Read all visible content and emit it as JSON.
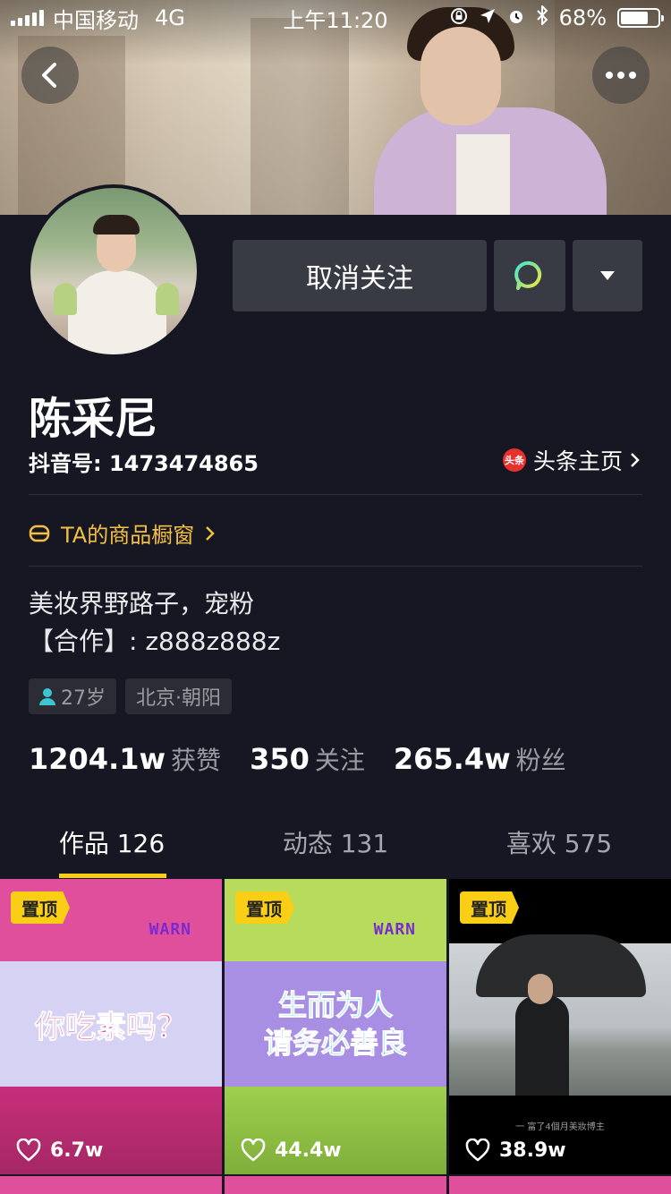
{
  "status_bar": {
    "carrier": "中国移动",
    "network": "4G",
    "time": "上午11:20",
    "battery": "68%",
    "battery_level": 0.68
  },
  "header": {
    "back_icon": "chevron-left-icon",
    "more_icon": "more-dots-icon"
  },
  "actions": {
    "unfollow_label": "取消关注",
    "message_icon": "message-bubble-icon",
    "dropdown_icon": "triangle-down-icon"
  },
  "profile": {
    "name": "陈采尼",
    "douyin_id": "抖音号: 1473474865",
    "toutiao_logo": "头条",
    "toutiao_label": "头条主页",
    "shop_label": "TA的商品橱窗",
    "bio_line1": "美妆界野路子，宠粉",
    "bio_line2": "【合作】: z888z888z",
    "tags": {
      "age": "27岁",
      "location": "北京·朝阳"
    }
  },
  "stats": [
    {
      "num": "1204.1w",
      "label": "获赞"
    },
    {
      "num": "350",
      "label": "关注"
    },
    {
      "num": "265.4w",
      "label": "粉丝"
    }
  ],
  "tabs": [
    {
      "label": "作品 126"
    },
    {
      "label": "动态 131"
    },
    {
      "label": "喜欢 575"
    }
  ],
  "videos": [
    {
      "pin": "置顶",
      "warn": "WARN",
      "title": "你吃素吗？",
      "likes": "6.7w"
    },
    {
      "pin": "置顶",
      "warn": "WARN",
      "title_line1": "生而为人",
      "title_line2": "请务必善良",
      "likes": "44.4w"
    },
    {
      "pin": "置顶",
      "caption": "一 富了4個月美妝博主",
      "likes": "38.9w"
    }
  ],
  "colors": {
    "background": "#161722",
    "accent": "#face15",
    "shop": "#f4c042",
    "button": "#393b44"
  }
}
